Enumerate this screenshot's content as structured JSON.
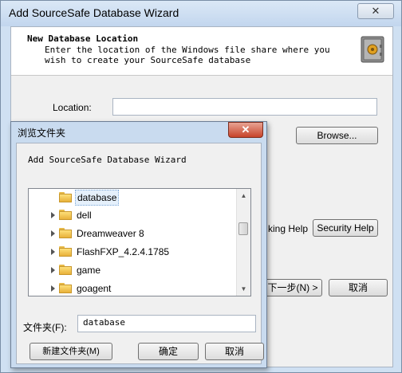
{
  "wizard": {
    "title": "Add SourceSafe Database Wizard",
    "close_glyph": "✕",
    "header_title": "New Database Location",
    "header_desc": "Enter the location of the Windows file share where you wish to create your SourceSafe database",
    "location_label": "Location:",
    "location_value": "",
    "browse_label": "Browse...",
    "checking_help_partial": "king Help",
    "security_help_label": "Security Help",
    "next_label": "下一步(N) >",
    "cancel_label": "取消"
  },
  "browse_dialog": {
    "title": "浏览文件夹",
    "close_glyph": "✕",
    "description": "Add SourceSafe Database Wizard",
    "tree_items": [
      {
        "label": "database",
        "selected": true
      },
      {
        "label": "dell"
      },
      {
        "label": "Dreamweaver 8"
      },
      {
        "label": "FlashFXP_4.2.4.1785"
      },
      {
        "label": "game"
      },
      {
        "label": "goagent"
      }
    ],
    "folder_label": "文件夹(F):",
    "folder_value": "database",
    "new_folder_label": "新建文件夹(M)",
    "ok_label": "确定",
    "cancel_label": "取消"
  },
  "colors": {
    "window_frame": "#c9dbef",
    "close_red": "#c7432a",
    "folder_yellow": "#fde07a"
  }
}
